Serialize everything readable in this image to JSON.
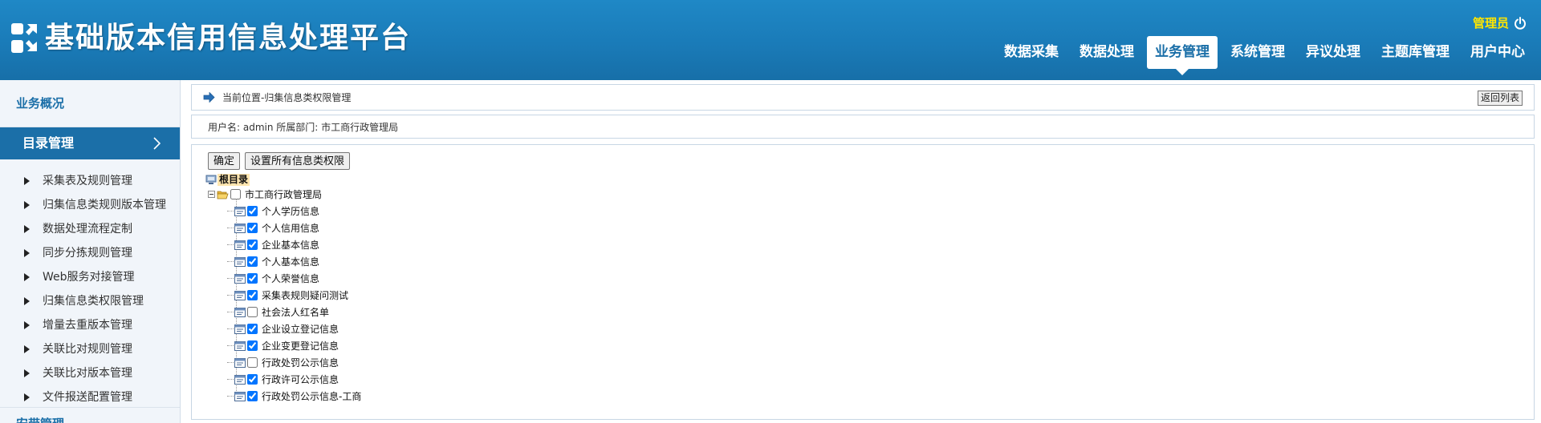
{
  "header": {
    "title": "基础版本信用信息处理平台",
    "user": "管理员",
    "nav": [
      {
        "label": "数据采集",
        "active": false
      },
      {
        "label": "数据处理",
        "active": false
      },
      {
        "label": "业务管理",
        "active": true
      },
      {
        "label": "系统管理",
        "active": false
      },
      {
        "label": "异议处理",
        "active": false
      },
      {
        "label": "主题库管理",
        "active": false
      },
      {
        "label": "用户中心",
        "active": false
      }
    ]
  },
  "sidebar": {
    "section_overview": "业务概况",
    "active_item": "目录管理",
    "items": [
      "采集表及规则管理",
      "归集信息类规则版本管理",
      "数据处理流程定制",
      "同步分拣规则管理",
      "Web服务对接管理",
      "归集信息类权限管理",
      "增量去重版本管理",
      "关联比对规则管理",
      "关联比对版本管理",
      "文件报送配置管理"
    ],
    "section_next": "安带管理"
  },
  "breadcrumb": {
    "text": "当前位置-归集信息类权限管理",
    "back_button": "返回列表"
  },
  "userinfo": {
    "text": "用户名: admin 所属部门: 市工商行政管理局"
  },
  "toolbar": {
    "confirm": "确定",
    "set_all": "设置所有信息类权限"
  },
  "tree": {
    "root": "根目录",
    "department": {
      "label": "市工商行政管理局",
      "checked": false
    },
    "leaves": [
      {
        "label": "个人学历信息",
        "checked": true
      },
      {
        "label": "个人信用信息",
        "checked": true
      },
      {
        "label": "企业基本信息",
        "checked": true
      },
      {
        "label": "个人基本信息",
        "checked": true
      },
      {
        "label": "个人荣誉信息",
        "checked": true
      },
      {
        "label": "采集表规则疑问测试",
        "checked": true
      },
      {
        "label": "社会法人红名单",
        "checked": false
      },
      {
        "label": "企业设立登记信息",
        "checked": true
      },
      {
        "label": "企业变更登记信息",
        "checked": true
      },
      {
        "label": "行政处罚公示信息",
        "checked": false
      },
      {
        "label": "行政许可公示信息",
        "checked": true
      },
      {
        "label": "行政处罚公示信息-工商",
        "checked": true
      }
    ]
  },
  "colors": {
    "header_blue": "#1a7bb8",
    "accent_blue": "#1b6fa8",
    "user_yellow": "#ffe600",
    "root_highlight": "#ffe6b0"
  }
}
